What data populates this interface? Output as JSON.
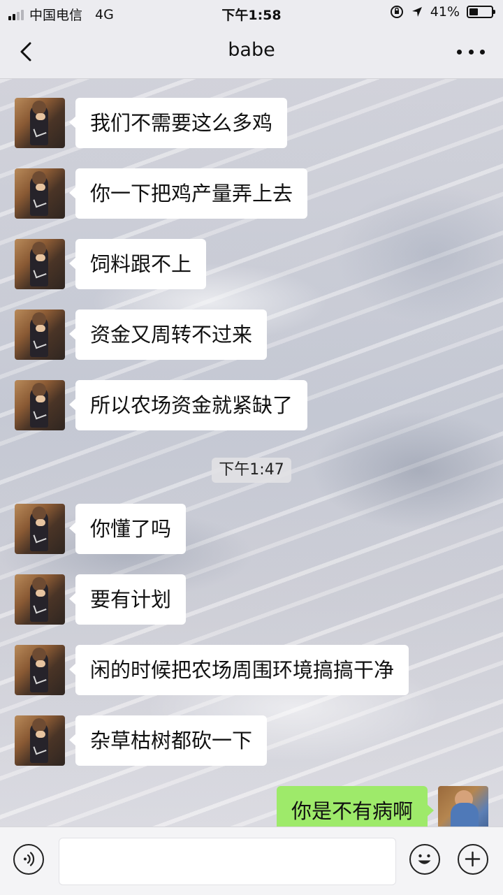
{
  "status_bar": {
    "carrier": "中国电信",
    "network": "4G",
    "time": "下午1:58",
    "battery_percent": "41%",
    "battery_level": 0.41,
    "signal_bars_active": 2,
    "signal_bars_total": 4
  },
  "nav": {
    "title": "babe",
    "back_icon": "chevron-left-icon",
    "more_icon": "more-dots-icon"
  },
  "messages_group1": [
    {
      "text": "我们不需要这么多鸡"
    },
    {
      "text": "你一下把鸡产量弄上去"
    },
    {
      "text": "饲料跟不上"
    },
    {
      "text": "资金又周转不过来"
    },
    {
      "text": "所以农场资金就紧缺了"
    }
  ],
  "timestamp": "下午1:47",
  "messages_group2": [
    {
      "text": "你懂了吗"
    },
    {
      "text": "要有计划"
    },
    {
      "text": "闲的时候把农场周围环境搞搞干净"
    },
    {
      "text": "杂草枯树都砍一下"
    }
  ],
  "sent_message": {
    "text": "你是不有病啊"
  },
  "input_bar": {
    "voice_icon": "voice-icon",
    "emoji_icon": "emoji-icon",
    "plus_icon": "plus-icon",
    "value": ""
  },
  "colors": {
    "incoming_bubble": "#ffffff",
    "outgoing_bubble": "#9eea6a",
    "bar_background": "#ececf0"
  }
}
